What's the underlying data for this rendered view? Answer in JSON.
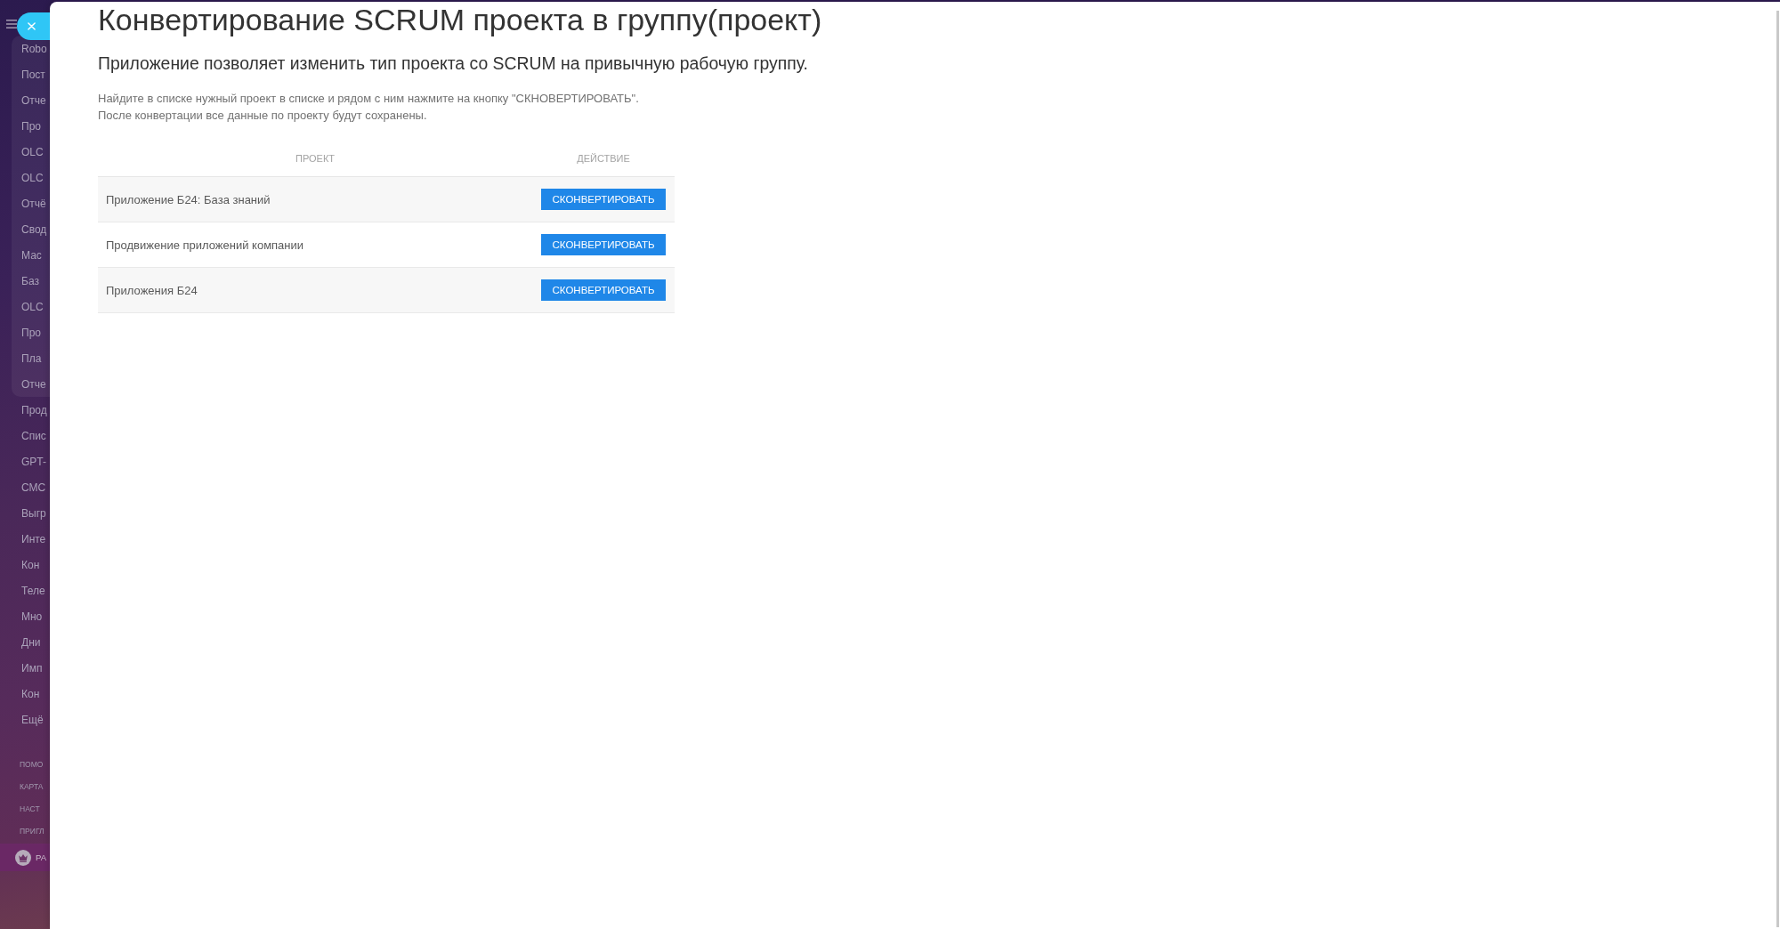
{
  "sidebar": {
    "group_items": [
      "Robo",
      "Пост",
      "Отче",
      "Про",
      "OLC",
      "OLC",
      "Отчё",
      "Свод",
      "Мас",
      "Баз",
      "OLC",
      "Про",
      "Пла",
      "Отче"
    ],
    "items": [
      "Прод",
      "Спис",
      "GPT-",
      "СМС",
      "Выгр",
      "Инте",
      "Кон",
      "Теле",
      "Мно",
      "Дни",
      "Имп",
      "Кон",
      "Ещё"
    ],
    "footer_links": [
      "ПОМО",
      "КАРТА",
      "НАСТ",
      "ПРИГЛ"
    ],
    "account": {
      "label": "РА"
    }
  },
  "panel": {
    "title": "Конвертирование SCRUM проекта в группу(проект)",
    "subtitle": "Приложение позволяет изменить тип проекта со SCRUM на привычную рабочую группу.",
    "instructions": [
      "Найдите в списке нужный проект в списке и рядом с ним нажмите на кнопку \"СКНОВЕРТИРОВАТЬ\".",
      "После конвертации все данные по проекту будут сохранены."
    ],
    "table": {
      "columns": [
        "ПРОЕКТ",
        "ДЕЙСТВИЕ"
      ],
      "rows": [
        {
          "project": "Приложение Б24: База знаний",
          "action": "СКОНВЕРТИРОВАТЬ"
        },
        {
          "project": "Продвижение приложений компании",
          "action": "СКОНВЕРТИРОВАТЬ"
        },
        {
          "project": "Приложения Б24",
          "action": "СКОНВЕРТИРОВАТЬ"
        }
      ]
    }
  }
}
